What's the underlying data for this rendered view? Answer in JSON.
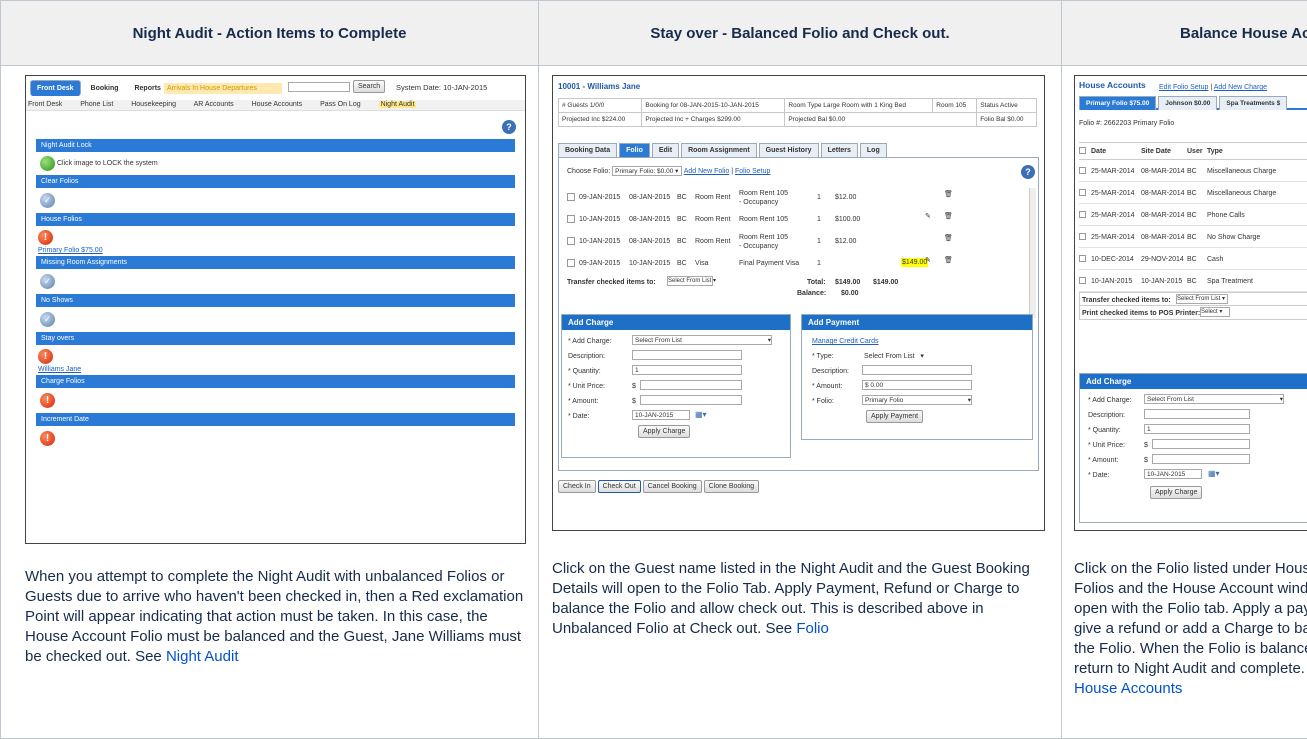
{
  "columns": [
    {
      "header": "Night Audit - Action Items to Complete",
      "caption_text": "When you attempt to complete the Night Audit with unbalanced Folios or Guests due to arrive who haven't been checked in, then a Red exclamation Point will appear indicating that action must be taken. In this case, the House Account Folio must be balanced and the Guest, Jane Williams must be checked out. See ",
      "caption_link": "Night Audit"
    },
    {
      "header": "Stay over - Balanced Folio and Check out.",
      "caption_text": "Click on the Guest name listed in the Night Audit and the Guest Booking Details will open to the Folio Tab. Apply Payment, Refund or Charge to balance the Folio and allow check out. This is described above in Unbalanced Folio at Check out. See ",
      "caption_link": "Folio"
    },
    {
      "header": "Balance House Accounts",
      "caption_text": "Click on the Folio listed under House Folios and the House Account window will open with the Folio tab. Apply a payment, give a refund or add a Charge to balance the Folio. When the Folio is balanced, return to Night Audit and complete. See ",
      "caption_link": "House Accounts"
    }
  ],
  "shot1": {
    "tabs": [
      "Front Desk",
      "Booking",
      "Reports"
    ],
    "arrivals_text": "Arrivals  In House  Departures",
    "search_label": "Search",
    "system_date": "System Date: 10-JAN-2015",
    "subnav": [
      "Front Desk",
      "Phone List",
      "Housekeeping",
      "AR Accounts",
      "House Accounts",
      "Pass On Log",
      "Night Audit"
    ],
    "sections": [
      {
        "title": "Night Audit Lock",
        "status": "green",
        "text": "Click image to LOCK the system",
        "link": ""
      },
      {
        "title": "Clear Folios",
        "status": "ok",
        "text": "",
        "link": ""
      },
      {
        "title": "House Folios",
        "status": "err",
        "text": "",
        "link": "Primary Folio $75.00"
      },
      {
        "title": "Missing Room Assignments",
        "status": "ok",
        "text": "",
        "link": ""
      },
      {
        "title": "No Shows",
        "status": "ok",
        "text": "",
        "link": ""
      },
      {
        "title": "Stay overs",
        "status": "err",
        "text": "",
        "link": "Williams Jane"
      },
      {
        "title": "Charge Folios",
        "status": "err",
        "text": "",
        "link": ""
      },
      {
        "title": "Increment Date",
        "status": "err",
        "text": "",
        "link": ""
      }
    ]
  },
  "shot2": {
    "title": "10001 - Williams Jane",
    "info": [
      [
        "# Guests 1/0/0",
        "Booking for 08-JAN-2015-10-JAN-2015",
        "Room Type Large Room with 1 King Bed",
        "Room 105",
        "Status Active"
      ],
      [
        "Projected Inc $224.00",
        "Projected Inc + Charges $299.00",
        "Projected Bal $0.00",
        "",
        "Folio Bal $0.00"
      ]
    ],
    "tabs": [
      "Booking Data",
      "Folio",
      "Edit",
      "Room Assignment",
      "Guest History",
      "Letters",
      "Log"
    ],
    "choose_folio": "Choose Folio:",
    "folio_select": "Primary Folio: $0.00",
    "add_folio": "Add New Folio",
    "folio_setup": "Folio Setup",
    "rows": [
      {
        "date1": "09-JAN-2015",
        "date2": "08-JAN-2015",
        "user": "BC",
        "type": "Room Rent",
        "desc": "Room Rent 105 - Occupancy",
        "qty": "1",
        "amt": "$12.00"
      },
      {
        "date1": "10-JAN-2015",
        "date2": "08-JAN-2015",
        "user": "BC",
        "type": "Room Rent",
        "desc": "Room Rent 105",
        "qty": "1",
        "amt": "$100.00"
      },
      {
        "date1": "10-JAN-2015",
        "date2": "08-JAN-2015",
        "user": "BC",
        "type": "Room Rent",
        "desc": "Room Rent 105 - Occupancy",
        "qty": "1",
        "amt": "$12.00"
      },
      {
        "date1": "09-JAN-2015",
        "date2": "10-JAN-2015",
        "user": "BC",
        "type": "Visa",
        "desc": "Final Payment Visa",
        "qty": "1",
        "amt": "$149.00"
      }
    ],
    "transfer_label": "Transfer checked items to:",
    "transfer_select": "Select From List",
    "total_label": "Total:",
    "total_val": "$149.00",
    "total_val2": "$149.00",
    "balance_label": "Balance:",
    "balance_val": "$0.00",
    "charge": {
      "title": "Add Charge",
      "add_charge": "* Add Charge:",
      "select": "Select From List",
      "description": "Description:",
      "quantity": "* Quantity:",
      "quantity_val": "1",
      "unit_price": "* Unit Price:",
      "amount": "* Amount:",
      "date": "* Date:",
      "date_val": "10-JAN-2015",
      "apply": "Apply Charge"
    },
    "payment": {
      "title": "Add Payment",
      "manage": "Manage Credit Cards",
      "type": "* Type:",
      "type_val": "Select From List",
      "description": "Description:",
      "amount": "* Amount:",
      "amount_val": "$ 0.00",
      "folio": "* Folio:",
      "folio_val": "Primary Folio",
      "apply": "Apply Payment"
    },
    "bottom_buttons": [
      "Check In",
      "Check Out",
      "Cancel Booking",
      "Clone Booking"
    ]
  },
  "shot3": {
    "title": "House Accounts",
    "edit_link": "Edit Folio Setup",
    "add_link": "Add New Charge",
    "tabs": [
      "Primary Folio $75.00",
      "Johnson $0.00",
      "Spa Treatments $"
    ],
    "folio_no": "Folio #: 2662203 Primary Folio",
    "headers": [
      "Date",
      "Site Date",
      "User",
      "Type"
    ],
    "rows": [
      [
        "25-MAR-2014",
        "08-MAR-2014",
        "BC",
        "Miscellaneous Charge"
      ],
      [
        "25-MAR-2014",
        "08-MAR-2014",
        "BC",
        "Miscellaneous Charge"
      ],
      [
        "25-MAR-2014",
        "08-MAR-2014",
        "BC",
        "Phone Calls"
      ],
      [
        "25-MAR-2014",
        "08-MAR-2014",
        "BC",
        "No Show Charge"
      ],
      [
        "10-DEC-2014",
        "29-NOV-2014",
        "BC",
        "Cash"
      ],
      [
        "10-JAN-2015",
        "10-JAN-2015",
        "BC",
        "Spa Treatment"
      ]
    ],
    "transfer_label": "Transfer checked items to:",
    "transfer_select": "Select From List",
    "print_label": "Print checked items to POS Printer:",
    "print_select": "Select",
    "charge": {
      "title": "Add Charge",
      "add_charge": "* Add Charge:",
      "select": "Select From List",
      "description": "Description:",
      "quantity": "* Quantity:",
      "quantity_val": "1",
      "unit_price": "* Unit Price:",
      "amount": "* Amount:",
      "date": "* Date:",
      "date_val": "10-JAN-2015",
      "apply": "Apply Charge"
    }
  }
}
